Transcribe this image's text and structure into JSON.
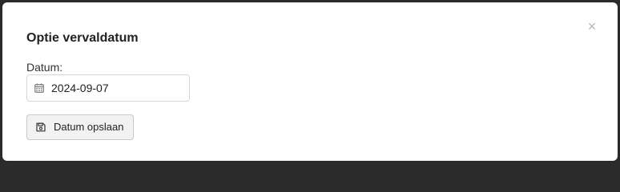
{
  "modal": {
    "title": "Optie vervaldatum",
    "close_symbol": "×"
  },
  "form": {
    "date_label": "Datum:",
    "date_value": "2024-09-07",
    "date_icon": "calendar-icon"
  },
  "actions": {
    "save_label": "Datum opslaan",
    "save_icon": "floppy-disk-icon"
  }
}
